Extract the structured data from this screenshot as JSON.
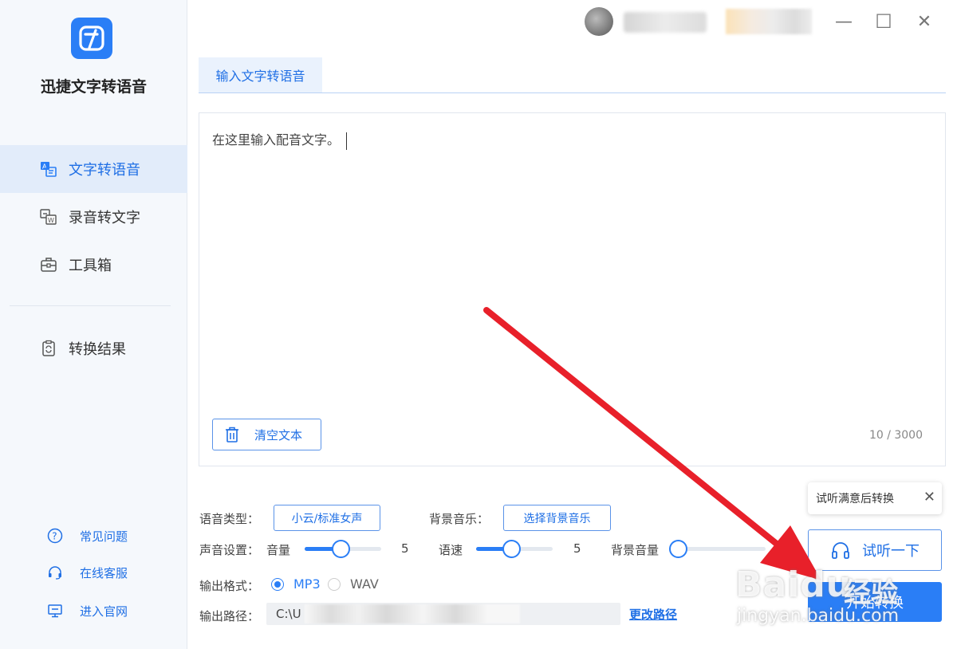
{
  "app": {
    "title": "迅捷文字转语音"
  },
  "sidebar": {
    "items": [
      {
        "label": "文字转语音",
        "icon": "text-to-speech-icon",
        "active": true
      },
      {
        "label": "录音转文字",
        "icon": "audio-to-text-icon",
        "active": false
      },
      {
        "label": "工具箱",
        "icon": "toolbox-icon",
        "active": false
      },
      {
        "label": "转换结果",
        "icon": "results-icon",
        "active": false
      }
    ],
    "footer": [
      {
        "label": "常见问题",
        "icon": "question-icon"
      },
      {
        "label": "在线客服",
        "icon": "headset-icon"
      },
      {
        "label": "进入官网",
        "icon": "monitor-icon"
      }
    ]
  },
  "window": {
    "minimize": "—",
    "maximize": "☐",
    "close": "✕"
  },
  "tabs": [
    {
      "label": "输入文字转语音"
    }
  ],
  "editor": {
    "text": "在这里输入配音文字。",
    "clear_label": "清空文本",
    "count": "10 / 3000"
  },
  "settings": {
    "voice_type_label": "语音类型：",
    "voice_type_value": "小云/标准女声",
    "bg_music_label": "背景音乐：",
    "bg_music_button": "选择背景音乐",
    "sound_label": "声音设置：",
    "volume_label": "音量",
    "volume_value": "5",
    "speed_label": "语速",
    "speed_value": "5",
    "bg_volume_label": "背景音量",
    "format_label": "输出格式：",
    "format_options": [
      "MP3",
      "WAV"
    ],
    "format_selected": "MP3",
    "path_label": "输出路径：",
    "path_value": "C:\\U",
    "change_path": "更改路径"
  },
  "actions": {
    "tooltip": "试听满意后转换",
    "tooltip_close": "✕",
    "preview": "试听一下",
    "convert": "开始转换"
  },
  "watermark": {
    "logo": "Baidu",
    "text": "经验",
    "url": "jingyan.baidu.com"
  },
  "colors": {
    "accent": "#2a7ef6",
    "sidebar_bg": "#f5f8fc",
    "active_bg": "#e2ecfa",
    "arrow": "#e8202a"
  }
}
